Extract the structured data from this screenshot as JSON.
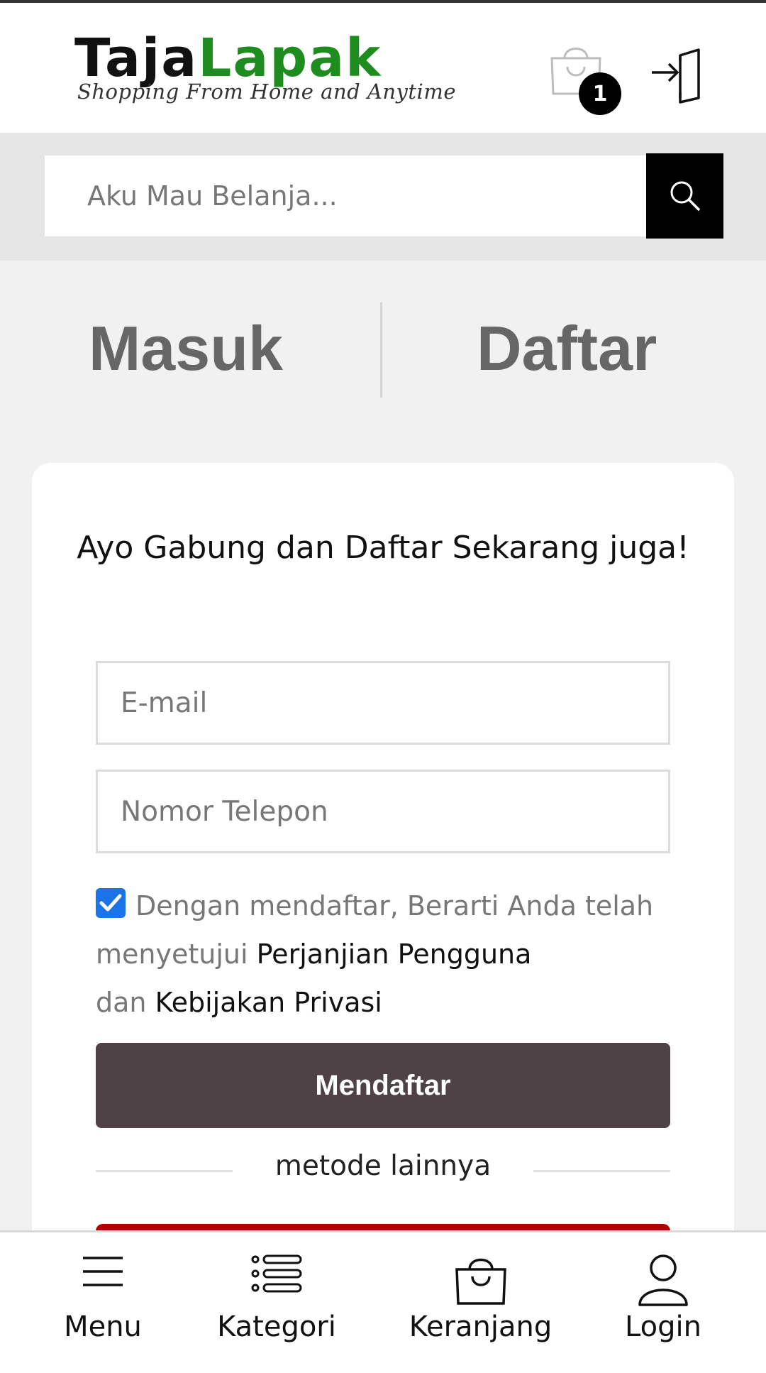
{
  "header": {
    "logo_part1": "Taja",
    "logo_part2": "Lapak",
    "tagline": "Shopping From Home and Anytime",
    "cart_count": "1"
  },
  "search": {
    "placeholder": "Aku Mau Belanja..."
  },
  "auth_tabs": {
    "login": "Masuk",
    "register": "Daftar"
  },
  "register_form": {
    "title": "Ayo Gabung dan Daftar Sekarang juga!",
    "email_placeholder": "E-mail",
    "phone_placeholder": "Nomor Telepon",
    "agree_text_1": "Dengan mendaftar, Berarti Anda telah menyetujui",
    "agree_link_1": "Perjanjian Pengguna",
    "agree_text_2": "dan",
    "agree_link_2": "Kebijakan Privasi",
    "agree_checked": true,
    "submit_label": "Mendaftar",
    "other_methods": "metode lainnya"
  },
  "bottom_nav": {
    "items": [
      {
        "label": "Menu",
        "icon": "hamburger-icon"
      },
      {
        "label": "Kategori",
        "icon": "list-icon"
      },
      {
        "label": "Keranjang",
        "icon": "shopping-bag-icon"
      },
      {
        "label": "Login",
        "icon": "user-icon"
      }
    ]
  },
  "colors": {
    "brand_green": "#1f8c1f",
    "submit_bg": "#4f4246",
    "checkbox_blue": "#1a73e8",
    "alt_login_red": "#b30000"
  }
}
